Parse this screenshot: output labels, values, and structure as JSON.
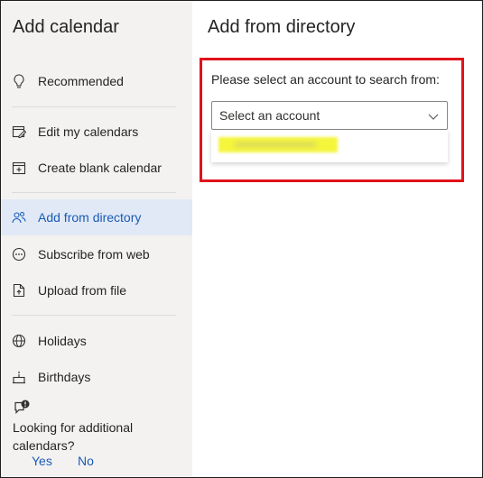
{
  "sidebar": {
    "title": "Add calendar",
    "items": [
      {
        "label": "Recommended",
        "icon": "lightbulb-icon"
      },
      {
        "label": "Edit my calendars",
        "icon": "edit-calendar-icon"
      },
      {
        "label": "Create blank calendar",
        "icon": "calendar-add-icon"
      },
      {
        "label": "Add from directory",
        "icon": "people-icon",
        "active": true
      },
      {
        "label": "Subscribe from web",
        "icon": "link-icon"
      },
      {
        "label": "Upload from file",
        "icon": "file-upload-icon"
      },
      {
        "label": "Holidays",
        "icon": "globe-icon"
      },
      {
        "label": "Birthdays",
        "icon": "cake-icon"
      }
    ],
    "footer": {
      "icon": "feedback-icon",
      "text": "Looking for additional calendars?",
      "yes": "Yes",
      "no": "No"
    }
  },
  "main": {
    "title": "Add from directory",
    "prompt": "Please select an account to search from:",
    "select": {
      "placeholder": "Select an account"
    }
  },
  "colors": {
    "accent": "#1a5bb5",
    "highlight": "#e0121b",
    "sidebar_bg": "#f3f2f1",
    "active_bg": "#e1e9f7"
  }
}
